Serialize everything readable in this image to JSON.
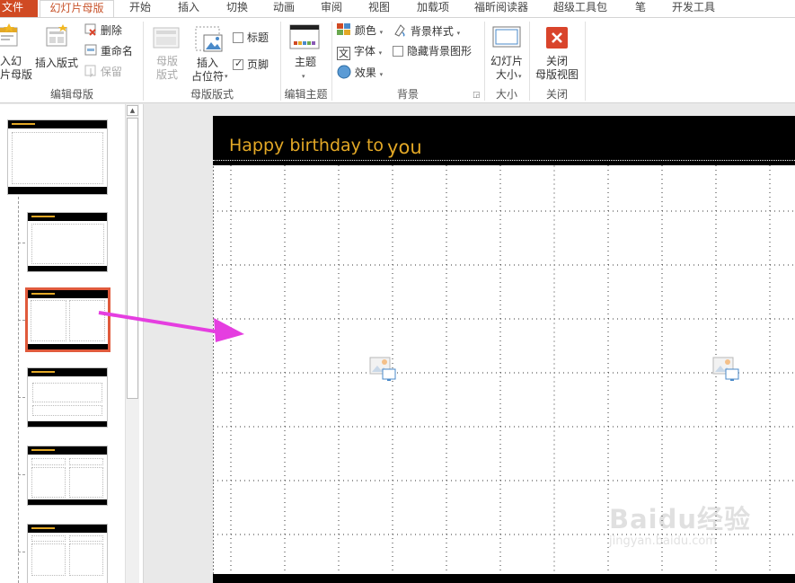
{
  "tabs": {
    "file": "文件",
    "slide_master": "幻灯片母版",
    "home": "开始",
    "insert": "插入",
    "transitions": "切换",
    "animations": "动画",
    "review": "审阅",
    "view": "视图",
    "addins": "加载项",
    "foxit": "福昕阅读器",
    "super_tools": "超级工具包",
    "pen": "笔",
    "developer": "开发工具"
  },
  "ribbon": {
    "edit_master": {
      "insert_slide_master_line1": "入幻",
      "insert_slide_master_line2": "片母版",
      "insert_layout": "插入版式",
      "delete": "删除",
      "rename": "重命名",
      "preserve": "保留",
      "label": "编辑母版"
    },
    "master_layout": {
      "master_layout_line1": "母版",
      "master_layout_line2": "版式",
      "insert_placeholder_line1": "插入",
      "insert_placeholder_line2": "占位符",
      "title_check": "标题",
      "footer_check": "页脚",
      "title_checked": false,
      "footer_checked": true,
      "label": "母版版式"
    },
    "edit_theme": {
      "themes": "主题",
      "label": "编辑主题"
    },
    "background": {
      "colors": "颜色",
      "fonts": "字体",
      "effects": "效果",
      "background_styles": "背景样式",
      "hide_background_graphics": "隐藏背景图形",
      "hide_checked": false,
      "label": "背景"
    },
    "size": {
      "slide_size_line1": "幻灯片",
      "slide_size_line2": "大小",
      "label": "大小"
    },
    "close": {
      "close_master_view_line1": "关闭",
      "close_master_view_line2": "母版视图",
      "label": "关闭"
    }
  },
  "slide": {
    "title_part1": "Happy birthday to",
    "title_part2": "you"
  },
  "watermark": {
    "main": "Baidu经验",
    "sub": "jingyan.baidu.com"
  },
  "colors": {
    "file_tab": "#d04a23",
    "active_tab_text": "#c8542c",
    "title_text": "#e3a826",
    "selection_border": "#e05a3c",
    "arrow": "#e53ee0",
    "close_icon": "#d9442b"
  },
  "icons": [
    "slide-master-icon",
    "layout-icon",
    "delete-icon",
    "rename-icon",
    "preserve-icon",
    "master-layout-icon",
    "placeholder-icon",
    "theme-icon",
    "colors-icon",
    "fonts-icon",
    "effects-icon",
    "background-styles-icon",
    "slide-size-icon",
    "close-icon",
    "picture-placeholder-icon"
  ]
}
